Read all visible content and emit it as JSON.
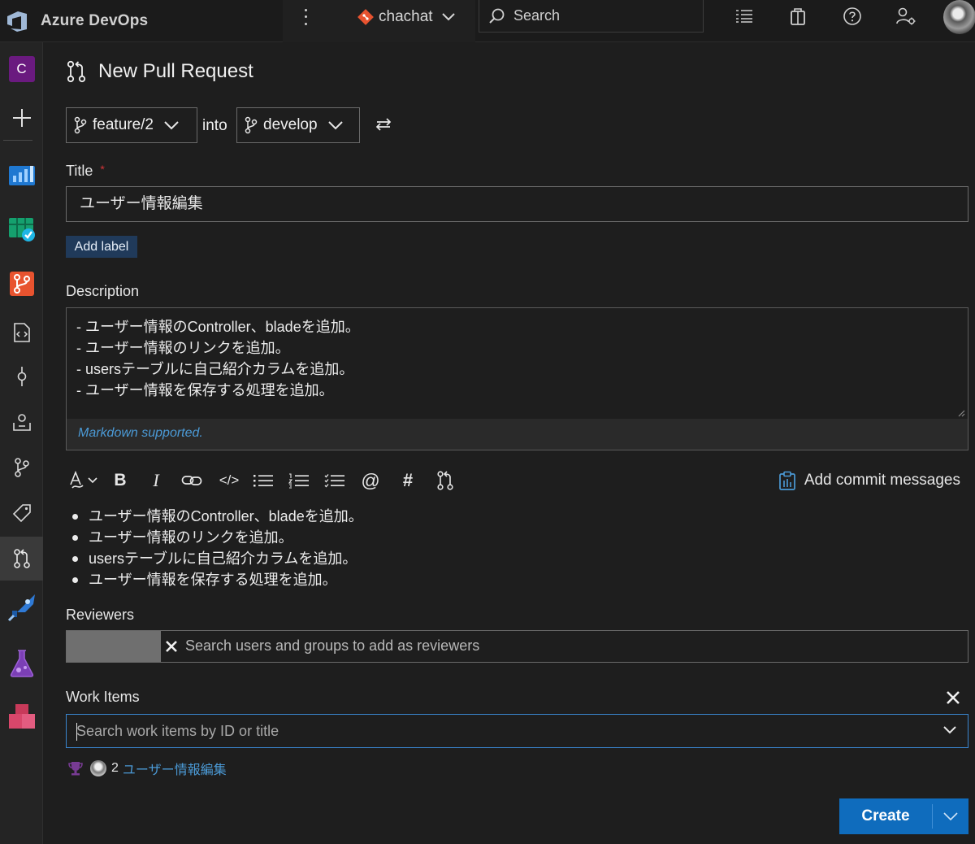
{
  "app": {
    "name": "Azure DevOps"
  },
  "header": {
    "project": "chachat",
    "search_placeholder": "Search"
  },
  "rail": {
    "org_initial": "C"
  },
  "page": {
    "title": "New Pull Request"
  },
  "branches": {
    "source": "feature/2",
    "into_label": "into",
    "target": "develop"
  },
  "title_field": {
    "label": "Title",
    "required_mark": "*",
    "value": "ユーザー情報編集"
  },
  "labels": {
    "add_label": "Add label"
  },
  "description": {
    "label": "Description",
    "text": "- ユーザー情報のController、bladeを追加。\n- ユーザー情報のリンクを追加。\n- usersテーブルに自己紹介カラムを追加。\n- ユーザー情報を保存する処理を追加。",
    "markdown_note": "Markdown supported."
  },
  "toolbar": {
    "bold": "B",
    "italic": "I",
    "code": "</>",
    "mention": "@",
    "hash": "#",
    "add_commit_messages": "Add commit messages"
  },
  "preview": {
    "items": [
      "ユーザー情報のController、bladeを追加。",
      "ユーザー情報のリンクを追加。",
      "usersテーブルに自己紹介カラムを追加。",
      "ユーザー情報を保存する処理を追加。"
    ]
  },
  "reviewers": {
    "label": "Reviewers",
    "placeholder": "Search users and groups to add as reviewers"
  },
  "work_items": {
    "label": "Work Items",
    "placeholder": "Search work items by ID or title",
    "linked": {
      "id": "2",
      "title": "ユーザー情報編集"
    }
  },
  "actions": {
    "create": "Create"
  },
  "colors": {
    "accent": "#0f6cbd",
    "link": "#4b9ad6",
    "focus_border": "#3a86d0",
    "required": "#d13438"
  }
}
